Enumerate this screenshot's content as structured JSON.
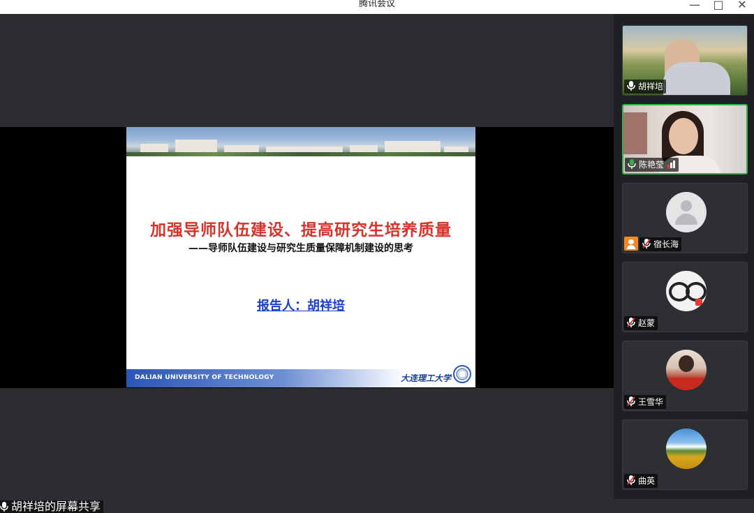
{
  "window": {
    "title": "腾讯会议",
    "minimize_glyph": "—",
    "maximize_glyph": "□",
    "close_glyph": "✕"
  },
  "slide": {
    "title": "加强导师队伍建设、提高研究生培养质量",
    "subtitle": "——导师队伍建设与研究生质量保障机制建设的思考",
    "presenter": "报告人：胡祥培",
    "footer_en": "DALIAN UNIVERSITY OF TECHNOLOGY",
    "footer_cn": "大连理工大学",
    "title_color": "#d6342a",
    "presenter_color": "#1a3fd0"
  },
  "share_label": "胡祥培的屏幕共享",
  "participants": [
    {
      "name": "胡祥培",
      "mic": "on",
      "video": "on",
      "speaking": false
    },
    {
      "name": "陈艳莹",
      "mic": "on",
      "video": "on",
      "speaking": true
    },
    {
      "name": "宿长海",
      "mic": "muted",
      "video": "off",
      "avatar": "default-avatar"
    },
    {
      "name": "赵蒙",
      "mic": "muted",
      "video": "off",
      "avatar": "glasses-avatar"
    },
    {
      "name": "王雪华",
      "mic": "muted",
      "video": "off",
      "avatar": "photo-avatar"
    },
    {
      "name": "曲英",
      "mic": "muted",
      "video": "off",
      "avatar": "sunflower-avatar"
    }
  ],
  "colors": {
    "active_speaker_border": "#33b249",
    "mic_on": "#ffffff",
    "signal_red": "#e53935"
  }
}
